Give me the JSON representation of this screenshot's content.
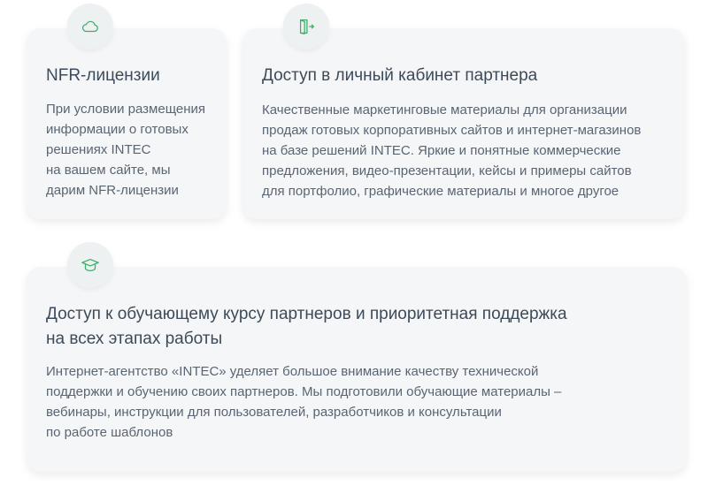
{
  "cards": [
    {
      "icon": "cloud-icon",
      "title": "NFR-лицензии",
      "text": "При условии размещения\nинформации о готовых\nрешениях INTEC\nна вашем сайте, мы\nдарим NFR-лицензии"
    },
    {
      "icon": "door-exit-icon",
      "title": "Доступ в личный кабинет партнера",
      "text": "Качественные маркетинговые материалы для организации\nпродаж готовых корпоративных сайтов и интернет-магазинов\nна базе решений INTEC. Яркие и понятные коммерческие\nпредложения, видео-презентации, кейсы и примеры сайтов\nдля портфолио, графические материалы и многое другое"
    },
    {
      "icon": "graduation-cap-icon",
      "title": "Доступ к обучающему курсу партнеров и приоритетная поддержка\nна всех этапах работы",
      "text": "Интернет-агентство «INTEC» уделяет большое внимание качеству технической\nподдержки и обучению своих партнеров. Мы подготовили обучающие материалы –\nвебинары, инструкции для пользователей, разработчиков и консультации\nпо работе шаблонов"
    }
  ],
  "colors": {
    "card_bg": "#f5f6f7",
    "icon_green": "#3fae6a",
    "title": "#3d4a5a",
    "body_text": "#5a6573"
  }
}
